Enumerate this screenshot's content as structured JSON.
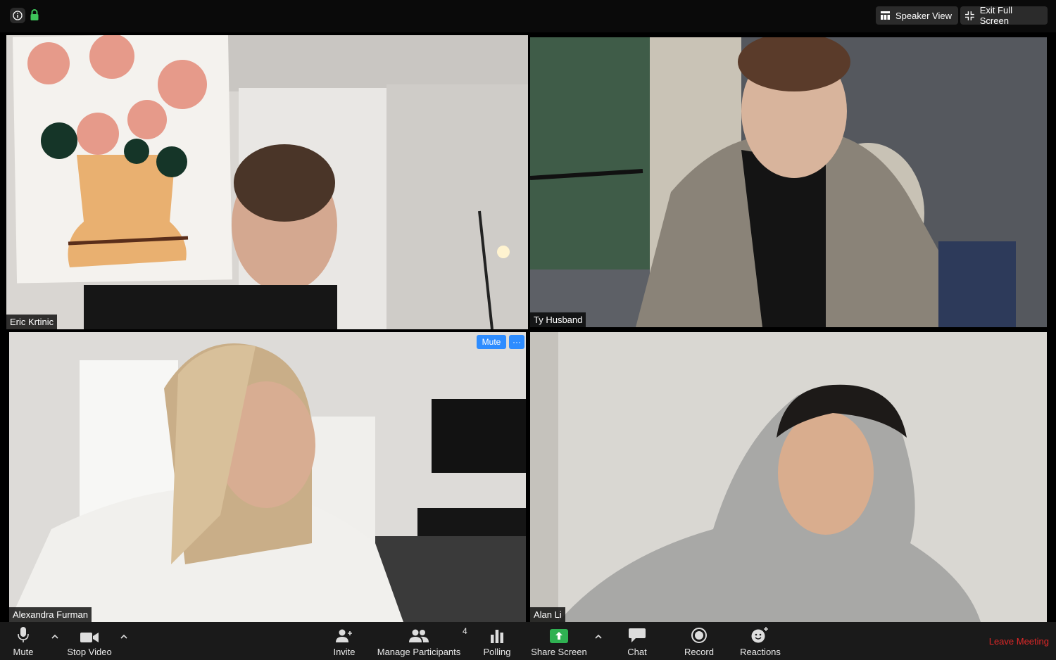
{
  "top_bar": {
    "speaker_view_label": "Speaker View",
    "exit_full_screen_label": "Exit Full Screen",
    "info_icon": "info-icon",
    "encryption_icon": "lock-icon"
  },
  "participants": [
    {
      "name": "Eric Krtinic",
      "active_speaker": true
    },
    {
      "name": "Ty Husband"
    },
    {
      "name": "Alexandra Furman"
    },
    {
      "name": "Alan Li"
    }
  ],
  "tile_overlay": {
    "mute_label": "Mute",
    "more_label": "···"
  },
  "toolbar": {
    "mute_label": "Mute",
    "stop_video_label": "Stop Video",
    "invite_label": "Invite",
    "manage_participants_label": "Manage Participants",
    "participant_count": "4",
    "polling_label": "Polling",
    "share_screen_label": "Share Screen",
    "chat_label": "Chat",
    "record_label": "Record",
    "reactions_label": "Reactions",
    "leave_label": "Leave Meeting"
  },
  "colors": {
    "active_speaker_border": "#e1ee8c",
    "share_screen_green": "#2fb152",
    "overlay_blue": "#2d8cff",
    "leave_red": "#e02828"
  }
}
